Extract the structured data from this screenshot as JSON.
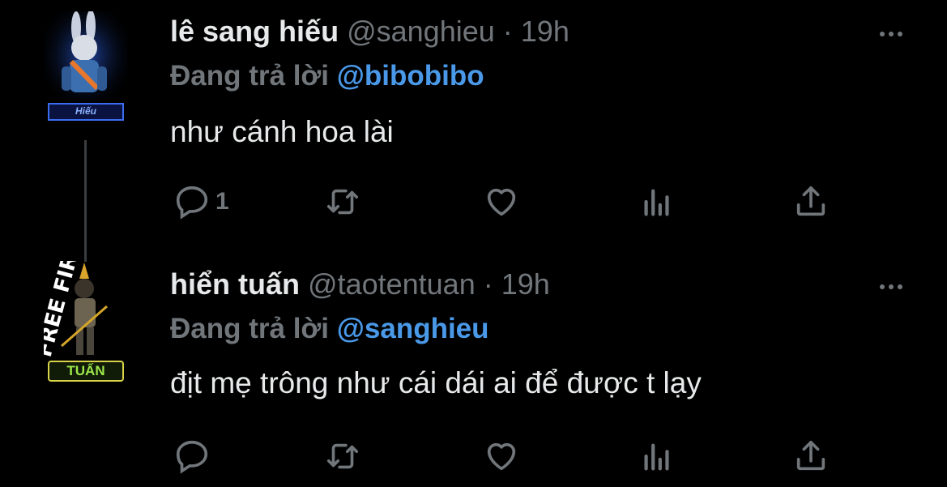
{
  "tweets": [
    {
      "name": "lê sang hiếu",
      "handle": "@sanghieu",
      "separator": "·",
      "time": "19h",
      "reply_label": "Đang trả lời",
      "reply_to": "@bibobibo",
      "text": "như cánh hoa lài",
      "avatar_caption": "Hiếu",
      "reply_count": "1"
    },
    {
      "name": "hiển tuấn",
      "handle": "@taotentuan",
      "separator": "·",
      "time": "19h",
      "reply_label": "Đang trả lời",
      "reply_to": "@sanghieu",
      "text": "địt mẹ trông như cái dái ai để được t lạy",
      "avatar_caption": "TUẤN",
      "reply_count": ""
    }
  ],
  "colors": {
    "background": "#000000",
    "muted": "#71767b",
    "link": "#4a99e9",
    "text": "#e7e9ea"
  },
  "icons": [
    "reply-icon",
    "retweet-icon",
    "like-icon",
    "analytics-icon",
    "share-icon",
    "more-icon"
  ]
}
